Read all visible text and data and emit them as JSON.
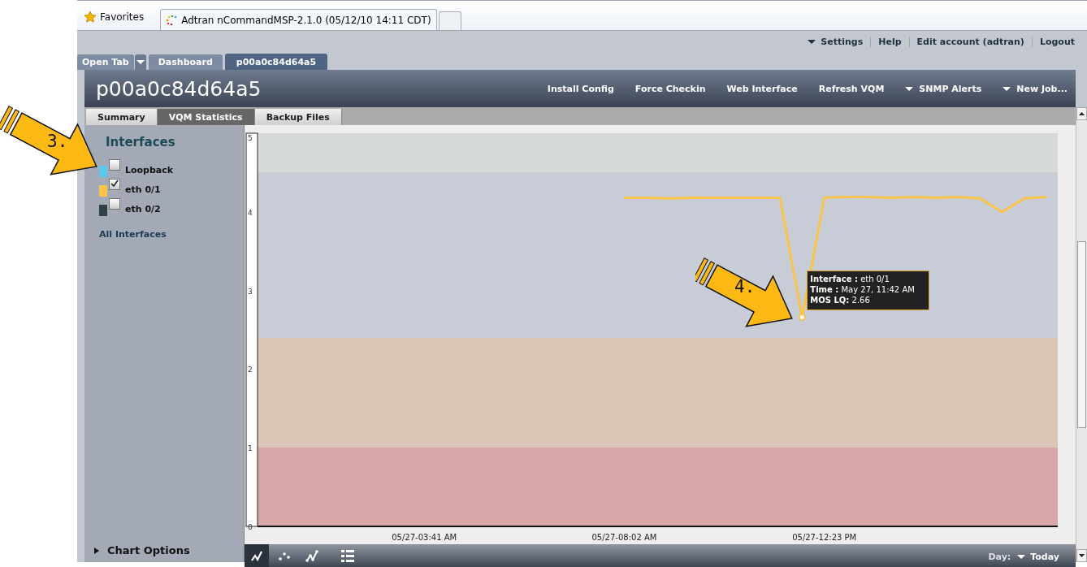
{
  "browser": {
    "favorites": "Favorites",
    "tabs": [
      {
        "title": "Adtran nCommandMSP-2.1.0 (05/12/10 14:11 CDT)",
        "selected": true
      }
    ]
  },
  "user_links": [
    {
      "label": "Settings",
      "dropdown": true
    },
    {
      "label": "Help",
      "dropdown": false
    },
    {
      "label": "Edit account (adtran)",
      "dropdown": false
    },
    {
      "label": "Logout",
      "dropdown": false
    }
  ],
  "app_tabs": [
    {
      "label": "Open Tab",
      "kind": "menu",
      "selected": false
    },
    {
      "label": "Dashboard",
      "kind": "tab",
      "selected": false
    },
    {
      "label": "p00a0c84d64a5",
      "kind": "tab",
      "selected": true
    }
  ],
  "device": {
    "title": "p00a0c84d64a5",
    "actions": [
      {
        "label": "Install Config",
        "dropdown": false
      },
      {
        "label": "Force Checkin",
        "dropdown": false
      },
      {
        "label": "Web Interface",
        "dropdown": false
      },
      {
        "label": "Refresh VQM",
        "dropdown": false
      },
      {
        "label": "SNMP Alerts",
        "dropdown": true
      },
      {
        "label": "New Job...",
        "dropdown": true
      }
    ]
  },
  "sub_tabs": [
    {
      "label": "Summary",
      "selected": false
    },
    {
      "label": "VQM Statistics",
      "selected": true
    },
    {
      "label": "Backup Files",
      "selected": false
    }
  ],
  "sidebar": {
    "heading": "Interfaces",
    "interfaces": [
      {
        "name": "Loopback",
        "color": "#5bc8ee",
        "checked": false
      },
      {
        "name": "eth 0/1",
        "color": "#f8c44a",
        "checked": true
      },
      {
        "name": "eth 0/2",
        "color": "#2f4347",
        "checked": false
      }
    ],
    "all_link": "All Interfaces",
    "chart_options": "Chart Options"
  },
  "chart": {
    "chart_data": {
      "type": "line",
      "categories": [
        null,
        null,
        null,
        null,
        null,
        null,
        null,
        "05/27-03:41 AM",
        null,
        null,
        null,
        null,
        null,
        null,
        null,
        null,
        "05/27-08:02 AM",
        null,
        null,
        null,
        null,
        null,
        null,
        null,
        null,
        "05/27-12:23 PM",
        null,
        null,
        null,
        null,
        null,
        null,
        null,
        null,
        null,
        null
      ],
      "series": [
        {
          "name": "eth 0/1",
          "color": "#f8c44a",
          "values": [
            null,
            null,
            null,
            null,
            null,
            null,
            null,
            null,
            null,
            null,
            null,
            null,
            null,
            null,
            null,
            null,
            4.18,
            4.18,
            4.17,
            4.18,
            4.18,
            4.18,
            4.18,
            4.18,
            2.66,
            4.18,
            4.19,
            4.19,
            4.18,
            4.19,
            4.18,
            4.19,
            4.17,
            4.0,
            4.17,
            4.19
          ]
        }
      ],
      "ylim": [
        0,
        5
      ],
      "yticks": [
        0,
        1,
        2,
        3,
        4,
        5
      ]
    },
    "tooltip": {
      "lines": [
        {
          "label": "Interface :",
          "kind": "series"
        },
        {
          "label": "Time :",
          "value": "May 27, 11:42 AM"
        },
        {
          "label": "MOS LQ:",
          "value": "2.66"
        }
      ]
    }
  },
  "toolbar": {
    "views": [
      {
        "kind": "line",
        "selected": true
      },
      {
        "kind": "scatter",
        "selected": false
      },
      {
        "kind": "points",
        "selected": false
      },
      {
        "kind": "list",
        "selected": false
      }
    ],
    "day_label": "Day:",
    "day_value": "Today"
  },
  "callouts": [
    "3.",
    "4."
  ]
}
